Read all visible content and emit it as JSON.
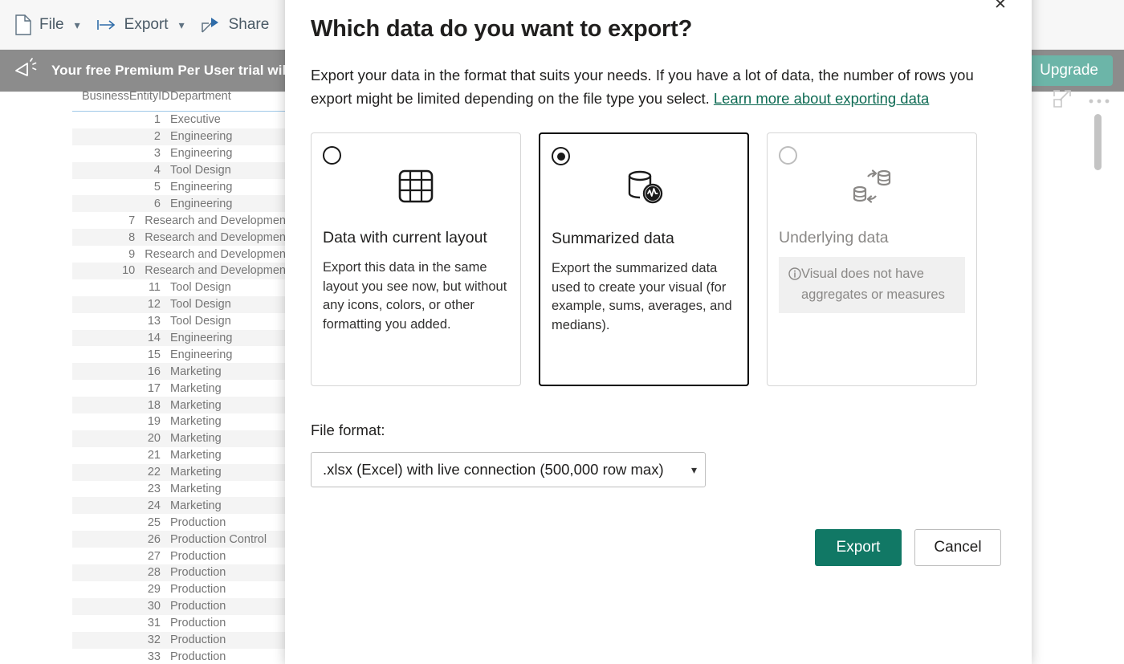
{
  "toolbar": {
    "items": [
      {
        "label": "File",
        "icon": "file-icon",
        "has_chevron": true
      },
      {
        "label": "Export",
        "icon": "export-arrow-icon",
        "has_chevron": true
      },
      {
        "label": "Share",
        "icon": "share-icon",
        "has_chevron": false
      }
    ]
  },
  "trial_banner": {
    "icon": "megaphone-icon",
    "message": "Your free Premium Per User trial will e",
    "upgrade_label": "Upgrade"
  },
  "visual_header": {
    "focus_mode_icon": "focus-mode-icon",
    "more_options_icon": "more-options-icon"
  },
  "table_visual": {
    "columns": [
      "BusinessEntityID",
      "Department"
    ],
    "rows": [
      {
        "id": "1",
        "department": "Executive"
      },
      {
        "id": "2",
        "department": "Engineering"
      },
      {
        "id": "3",
        "department": "Engineering"
      },
      {
        "id": "4",
        "department": "Tool Design"
      },
      {
        "id": "5",
        "department": "Engineering"
      },
      {
        "id": "6",
        "department": "Engineering"
      },
      {
        "id": "7",
        "department": "Research and Development"
      },
      {
        "id": "8",
        "department": "Research and Development"
      },
      {
        "id": "9",
        "department": "Research and Development"
      },
      {
        "id": "10",
        "department": "Research and Development"
      },
      {
        "id": "11",
        "department": "Tool Design"
      },
      {
        "id": "12",
        "department": "Tool Design"
      },
      {
        "id": "13",
        "department": "Tool Design"
      },
      {
        "id": "14",
        "department": "Engineering"
      },
      {
        "id": "15",
        "department": "Engineering"
      },
      {
        "id": "16",
        "department": "Marketing"
      },
      {
        "id": "17",
        "department": "Marketing"
      },
      {
        "id": "18",
        "department": "Marketing"
      },
      {
        "id": "19",
        "department": "Marketing"
      },
      {
        "id": "20",
        "department": "Marketing"
      },
      {
        "id": "21",
        "department": "Marketing"
      },
      {
        "id": "22",
        "department": "Marketing"
      },
      {
        "id": "23",
        "department": "Marketing"
      },
      {
        "id": "24",
        "department": "Marketing"
      },
      {
        "id": "25",
        "department": "Production"
      },
      {
        "id": "26",
        "department": "Production Control"
      },
      {
        "id": "27",
        "department": "Production"
      },
      {
        "id": "28",
        "department": "Production"
      },
      {
        "id": "29",
        "department": "Production"
      },
      {
        "id": "30",
        "department": "Production"
      },
      {
        "id": "31",
        "department": "Production"
      },
      {
        "id": "32",
        "department": "Production"
      },
      {
        "id": "33",
        "department": "Production"
      }
    ]
  },
  "dialog": {
    "close_label": "✕",
    "title": "Which data do you want to export?",
    "description_part1": "Export your data in the format that suits your needs. If you have a lot of data, the number of rows you export might be limited depending on the file type you select. ",
    "link_label": "Learn more about exporting data",
    "options": [
      {
        "id": "data-with-current-layout",
        "title": "Data with current layout",
        "description": "Export this data in the same layout you see now, but without any icons, colors, or other formatting you added.",
        "icon": "table-grid-icon",
        "selected": false,
        "disabled": false,
        "note": ""
      },
      {
        "id": "summarized-data",
        "title": "Summarized data",
        "description": "Export the summarized data used to create your visual (for example, sums, averages, and medians).",
        "icon": "database-summary-icon",
        "selected": true,
        "disabled": false,
        "note": ""
      },
      {
        "id": "underlying-data",
        "title": "Underlying data",
        "description": "",
        "icon": "databases-exchange-icon",
        "selected": false,
        "disabled": true,
        "note": "Visual does not have aggregates or measures",
        "note_icon": "info-icon"
      }
    ],
    "file_format": {
      "label": "File format:",
      "selected": ".xlsx (Excel) with live connection (500,000 row max)",
      "chevron_icon": "chevron-down-icon"
    },
    "footer": {
      "export_label": "Export",
      "cancel_label": "Cancel"
    }
  },
  "colors": {
    "primary_green": "#117865",
    "link_green": "#0f6b54",
    "banner_gray": "#8c8c8c",
    "upgrade_teal": "#6cb5a8"
  }
}
